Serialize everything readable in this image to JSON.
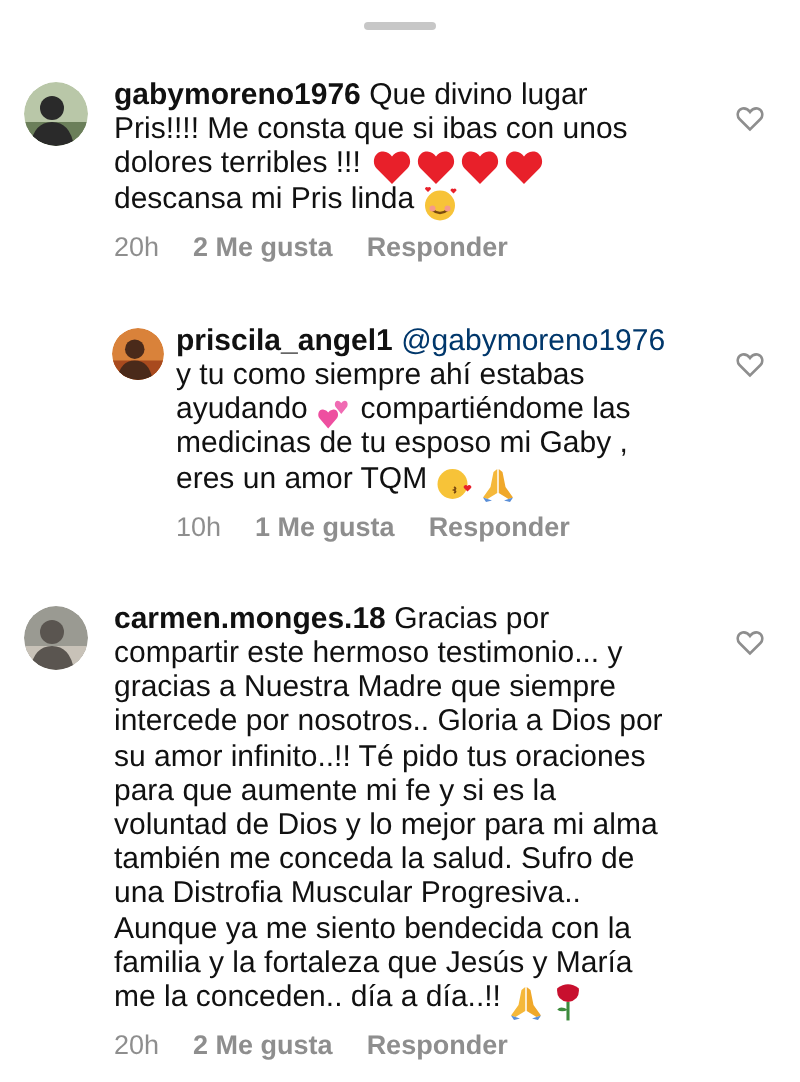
{
  "comments": [
    {
      "username": "gabymoreno1976",
      "avatar": {
        "kind": "picture"
      },
      "liked": false,
      "reply": false,
      "body": [
        {
          "kind": "text",
          "text": "Que divino lugar Pris!!!! Me consta que si ibas con unos dolores terribles !!! "
        },
        {
          "kind": "heart"
        },
        {
          "kind": "heart"
        },
        {
          "kind": "heart"
        },
        {
          "kind": "heart"
        },
        {
          "kind": "text",
          "text": " descansa mi Pris linda "
        },
        {
          "kind": "smile-hearts"
        }
      ],
      "time": "20h",
      "likes": "2 Me gusta",
      "reply_label": "Responder"
    },
    {
      "username": "priscila_angel1",
      "avatar": {
        "kind": "picture"
      },
      "liked": false,
      "reply": true,
      "body": [
        {
          "kind": "mention",
          "text": "@gabymoreno1976"
        },
        {
          "kind": "text",
          "text": " y tu como siempre ahí estabas ayudando "
        },
        {
          "kind": "two-hearts"
        },
        {
          "kind": "text",
          "text": " compartiéndome las medicinas de tu esposo mi Gaby , eres un amor TQM "
        },
        {
          "kind": "kiss"
        },
        {
          "kind": "pray"
        }
      ],
      "time": "10h",
      "likes": "1 Me gusta",
      "reply_label": "Responder"
    },
    {
      "username": "carmen.monges.18",
      "avatar": {
        "kind": "picture"
      },
      "liked": false,
      "reply": false,
      "body": [
        {
          "kind": "text",
          "text": "Gracias por compartir este hermoso testimonio... y gracias a Nuestra Madre que siempre intercede por nosotros.. Gloria a Dios por su amor infinito..!! Té pido tus oraciones para que aumente mi fe y si es la voluntad de Dios y lo mejor para mi alma también me conceda la salud. Sufro de una Distrofia Muscular Progresiva.. Aunque ya me siento bendecida con la familia y la fortaleza que Jesús y María me la conceden.. día a día..!!"
        },
        {
          "kind": "pray"
        },
        {
          "kind": "rose"
        }
      ],
      "time": "20h",
      "likes": "2 Me gusta",
      "reply_label": "Responder"
    }
  ]
}
